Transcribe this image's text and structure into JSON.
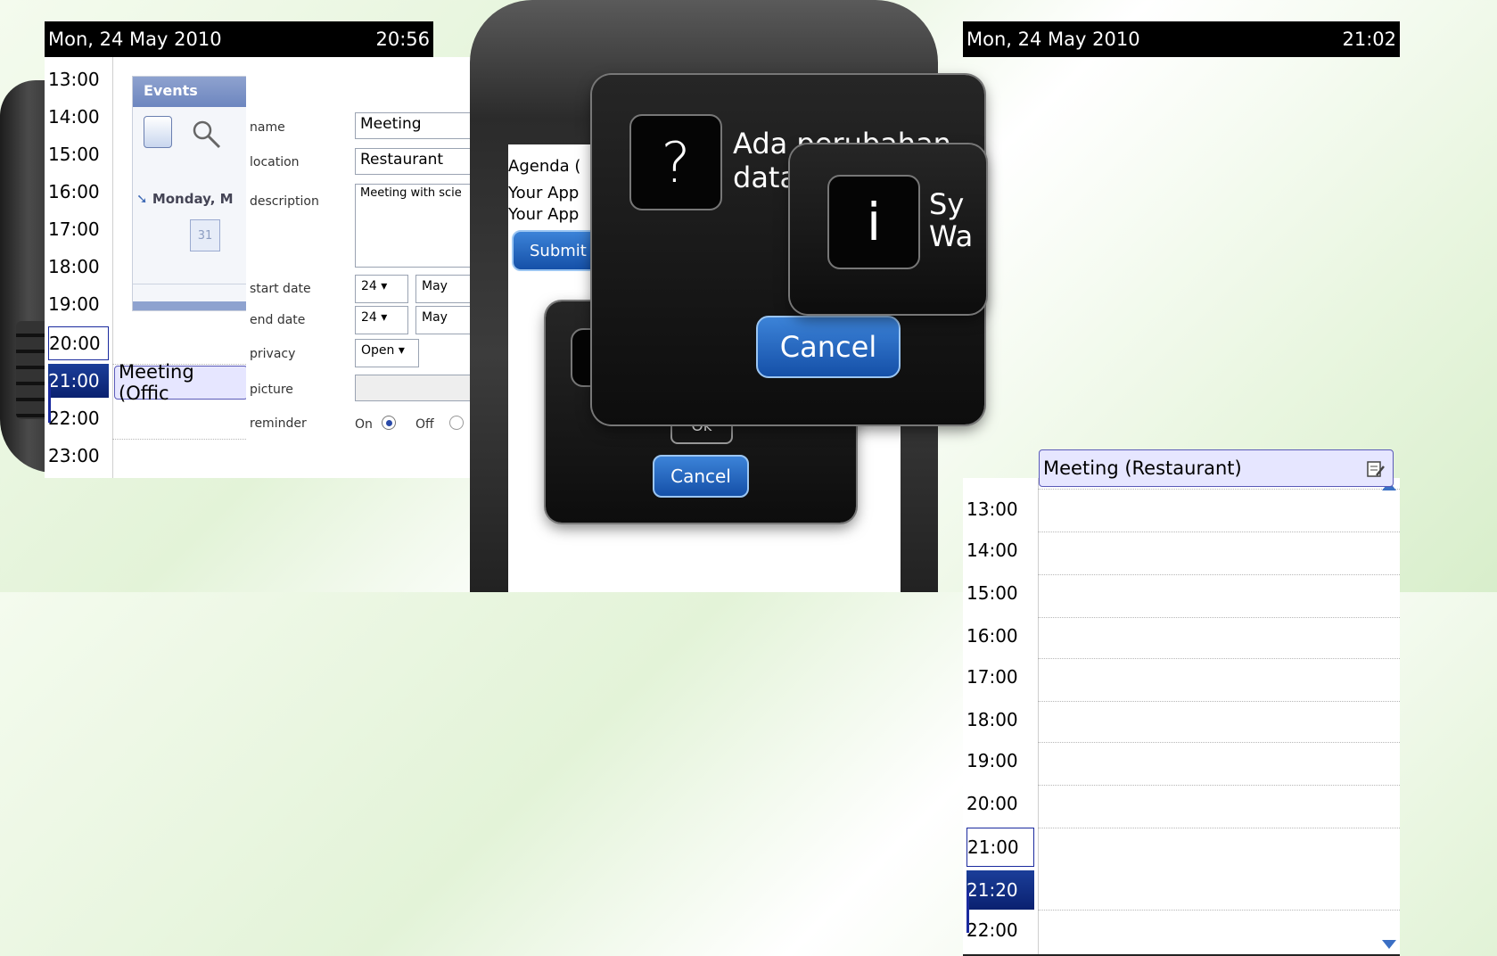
{
  "left_calendar": {
    "date": "Mon, 24 May 2010",
    "clock": "20:56",
    "hours": [
      "13:00",
      "14:00",
      "15:00",
      "16:00",
      "17:00",
      "18:00",
      "19:00",
      "20:00",
      "21:00",
      "22:00",
      "23:00"
    ],
    "event_label": "Meeting (Offic"
  },
  "events_panel": {
    "title": "Events",
    "date_label": "Monday, M",
    "calendar_icon_day": "31"
  },
  "form": {
    "name_label": "name",
    "name_value": "Meeting",
    "location_label": "location",
    "location_value": "Restaurant",
    "description_label": "description",
    "description_value": "Meeting with scie",
    "start_date_label": "start date",
    "start_day": "24",
    "start_month": "May",
    "end_date_label": "end date",
    "end_day": "24",
    "end_month": "May",
    "privacy_label": "privacy",
    "privacy_value": "Open",
    "picture_label": "picture",
    "reminder_label": "reminder",
    "reminder_on": "On",
    "reminder_off": "Off"
  },
  "center_phone": {
    "agenda_title": "Agenda (",
    "line1": "Your App",
    "line2": "Your App",
    "submit_label": "Submit",
    "dialog_back_cancel": "Cancel",
    "dialog_back_ok": "Ok",
    "dialog_mid_text1": "Ada perubahan",
    "dialog_mid_text2": "data",
    "dialog_mid_cancel": "Cancel",
    "dialog_front_text1": "Sy",
    "dialog_front_text2": "Wa"
  },
  "right_calendar": {
    "date": "Mon, 24 May 2010",
    "clock": "21:02",
    "hours": [
      "13:00",
      "14:00",
      "15:00",
      "16:00",
      "17:00",
      "18:00",
      "19:00",
      "20:00",
      "21:00",
      "21:20",
      "22:00"
    ],
    "event_label": "Meeting (Restaurant)"
  },
  "colors": {
    "accent_blue": "#1b3e99",
    "event_bg": "#e6e6ff",
    "button_blue": "#1550a8"
  }
}
